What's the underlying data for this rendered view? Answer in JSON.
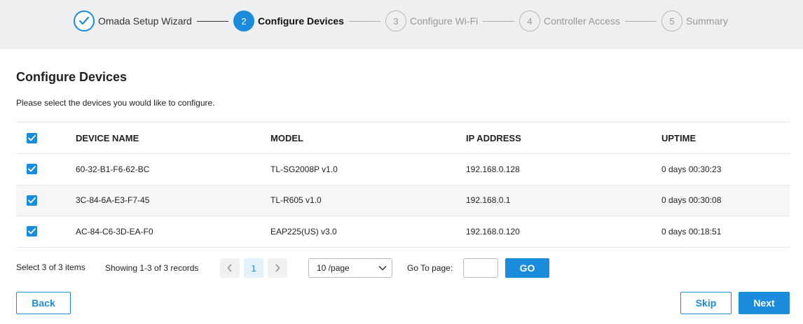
{
  "wizard": {
    "steps": [
      {
        "number": "",
        "label": "Omada Setup Wizard",
        "state": "done"
      },
      {
        "number": "2",
        "label": "Configure Devices",
        "state": "active"
      },
      {
        "number": "3",
        "label": "Configure Wi-Fi",
        "state": "pending"
      },
      {
        "number": "4",
        "label": "Controller Access",
        "state": "pending"
      },
      {
        "number": "5",
        "label": "Summary",
        "state": "pending"
      }
    ]
  },
  "main": {
    "title": "Configure Devices",
    "subtitle": "Please select the devices you would like to configure."
  },
  "table": {
    "headers": {
      "name": "DEVICE NAME",
      "model": "MODEL",
      "ip": "IP ADDRESS",
      "uptime": "UPTIME"
    },
    "rows": [
      {
        "name": "60-32-B1-F6-62-BC",
        "model": "TL-SG2008P v1.0",
        "ip": "192.168.0.128",
        "uptime": "0 days 00:30:23",
        "checked": true
      },
      {
        "name": "3C-84-6A-E3-F7-45",
        "model": "TL-R605 v1.0",
        "ip": "192.168.0.1",
        "uptime": "0 days 00:30:08",
        "checked": true
      },
      {
        "name": "AC-84-C6-3D-EA-F0",
        "model": "EAP225(US) v3.0",
        "ip": "192.168.0.120",
        "uptime": "0 days 00:18:51",
        "checked": true
      }
    ]
  },
  "pagination": {
    "select_info": "Select 3 of 3 items",
    "showing": "Showing 1-3 of 3 records",
    "current_page": "1",
    "per_page": "10 /page",
    "goto_label": "Go To page:",
    "goto_value": "",
    "go_label": "GO"
  },
  "footer": {
    "back_label": "Back",
    "skip_label": "Skip",
    "next_label": "Next"
  },
  "colors": {
    "accent": "#1a8cdb",
    "header_bg": "#eeeff1",
    "row_alt": "#f5f6f7"
  },
  "icons": {
    "done_step": "checkmark-icon",
    "checkbox": "checkbox-checked-icon",
    "prev": "chevron-left-icon",
    "next": "chevron-right-icon",
    "dropdown": "chevron-down-icon"
  }
}
